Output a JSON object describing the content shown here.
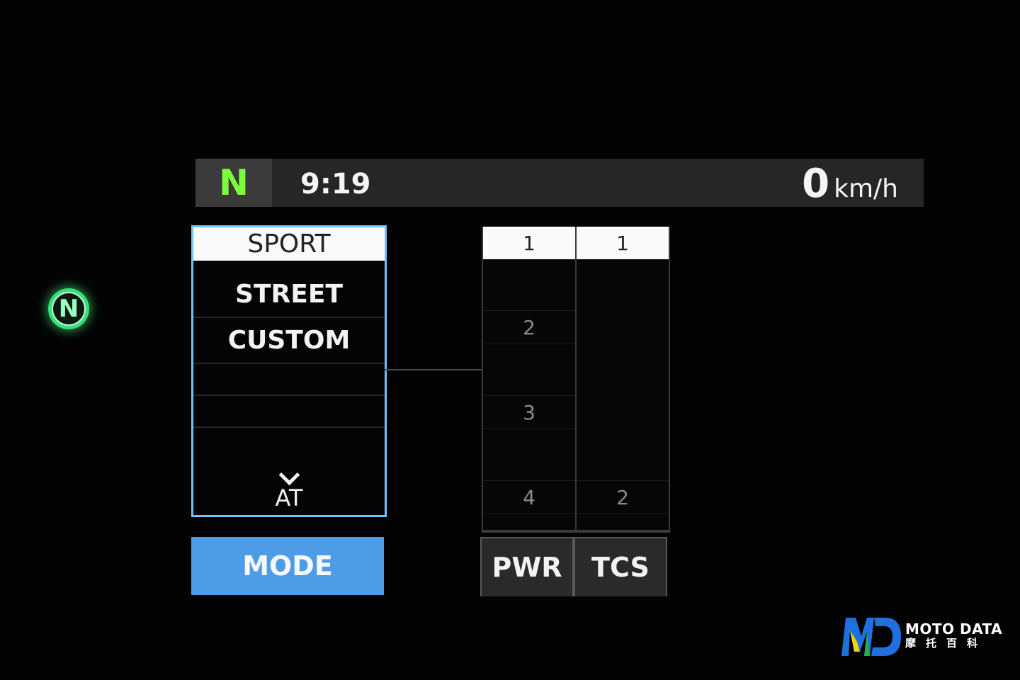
{
  "indicator": {
    "neutral_letter": "N",
    "color": "#36e07a"
  },
  "status_bar": {
    "gear": "N",
    "gear_color": "#7dff3a",
    "clock": "9:19",
    "speed": "0",
    "speed_unit": "km/h"
  },
  "mode_list": {
    "items": [
      {
        "label": "SPORT",
        "selected": true
      },
      {
        "label": "STREET",
        "selected": false
      },
      {
        "label": "CUSTOM",
        "selected": false
      }
    ],
    "more_label": "AT",
    "more_icon": "chevron-down-icon",
    "border_color": "#6fc3ff"
  },
  "mode_button": {
    "label": "MODE",
    "color": "#4f9ce6"
  },
  "pwr": {
    "tab_label": "PWR",
    "selected_level": "1",
    "levels": [
      "2",
      "3",
      "4"
    ]
  },
  "tcs": {
    "tab_label": "TCS",
    "selected_level": "1",
    "levels": [
      "2"
    ]
  },
  "watermark": {
    "line1": "MOTO DATA",
    "line2": "摩托百科"
  }
}
